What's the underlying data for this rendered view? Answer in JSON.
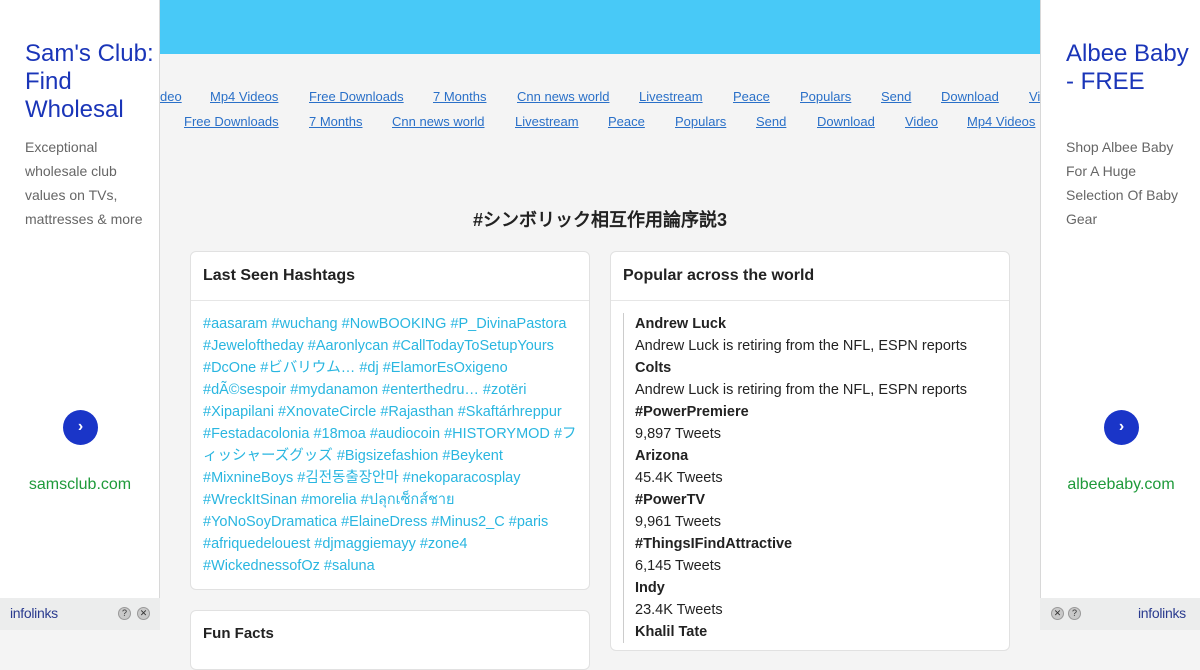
{
  "nav": {
    "row1": [
      "deo",
      "Mp4 Videos",
      "Free Downloads",
      "7 Months",
      "Cnn news world",
      "Livestream",
      "Peace",
      "Populars",
      "Send",
      "Download",
      "Vi"
    ],
    "row2": [
      "Free Downloads",
      "7 Months",
      "Cnn news world",
      "Livestream",
      "Peace",
      "Populars",
      "Send",
      "Download",
      "Video",
      "Mp4 Videos"
    ]
  },
  "page": {
    "title": "#シンボリック相互作用論序説3"
  },
  "last_seen": {
    "heading": "Last Seen Hashtags",
    "tags": [
      "#aasaram",
      "#wuchang",
      "#NowBOOKING",
      "#P_DivinaPastora",
      "#Jeweloftheday",
      "#Aaronlycan",
      "#CallTodayToSetupYours",
      "#DcOne",
      "#ビバリウム…",
      "#dj",
      "#ElamorEsOxigeno",
      "#dÃ©sespoir",
      "#mydanamon",
      "#enterthedru…",
      "#zotëri",
      "#Xipapilani",
      "#XnovateCircle",
      "#Rajasthan",
      "#Skaftárhreppur",
      "#Festadacolonia",
      "#18moa",
      "#audiocoin",
      "#HISTORYMOD",
      "#フィッシャーズグッズ",
      "#Bigsizefashion",
      "#Beykent",
      "#MixnineBoys",
      "#김전동출장안마",
      "#nekoparacosplay",
      "#WreckItSinan",
      "#morelia",
      "#ปลุกเซ็กส์ชาย",
      "#YoNoSoyDramatica",
      "#ElaineDress",
      "#Minus2_C",
      "#paris",
      "#afriquedelouest",
      "#djmaggiemayy",
      "#zone4",
      "#WickednessofOz",
      "#saluna"
    ]
  },
  "popular": {
    "heading": "Popular across the world",
    "trends": [
      {
        "name": "Andrew Luck",
        "detail": "Andrew Luck is retiring from the NFL, ESPN reports"
      },
      {
        "name": "Colts",
        "detail": "Andrew Luck is retiring from the NFL, ESPN reports"
      },
      {
        "name": "#PowerPremiere",
        "detail": "9,897 Tweets"
      },
      {
        "name": "Arizona",
        "detail": "45.4K Tweets"
      },
      {
        "name": "#PowerTV",
        "detail": "9,961 Tweets"
      },
      {
        "name": "#ThingsIFindAttractive",
        "detail": "6,145 Tweets"
      },
      {
        "name": "Indy",
        "detail": "23.4K Tweets"
      },
      {
        "name": "Khalil Tate",
        "detail": ""
      }
    ]
  },
  "extra_card": {
    "heading": "Fun Facts"
  },
  "ad_left": {
    "title": "Sam's Club: Find Wholesal",
    "description": "Exceptional wholesale club values on TVs, mattresses & more",
    "domain": "samsclub.com",
    "arrow": "›"
  },
  "ad_right": {
    "title": "Albee Baby - FREE",
    "description": "Shop Albee Baby For A Huge Selection Of Baby Gear",
    "domain": "albeebaby.com",
    "arrow": "›"
  },
  "footer": {
    "brand_left": "infolinks",
    "brand_right": "infolinks",
    "help_glyph": "?",
    "close_glyph": "✕"
  },
  "colors": {
    "topbar": "#48c9f7",
    "link": "#2a70c8",
    "hashtag": "#29b6e0",
    "ad_title": "#1a35b8",
    "ad_domain": "#1e9a3a",
    "arrow_button": "#1a35c8"
  }
}
